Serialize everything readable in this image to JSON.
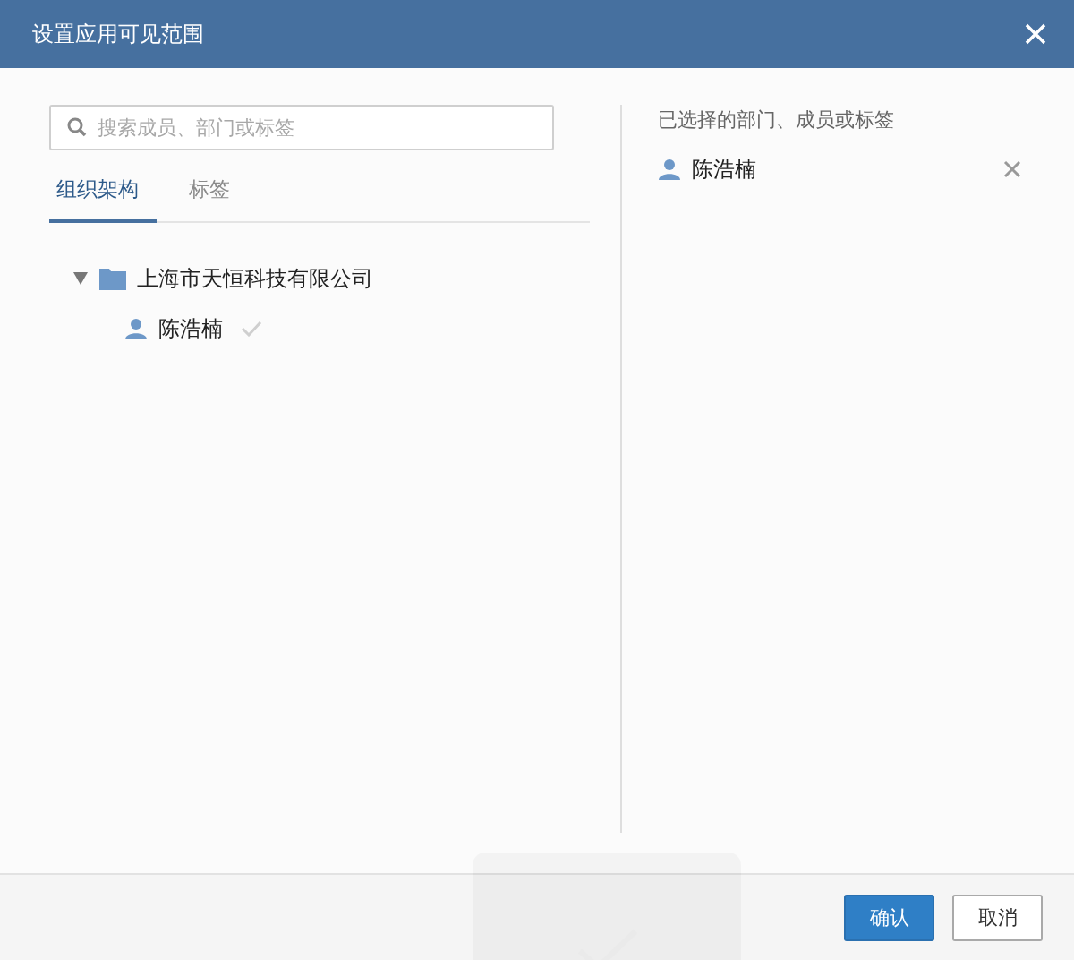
{
  "dialog": {
    "title": "设置应用可见范围"
  },
  "search": {
    "placeholder": "搜索成员、部门或标签"
  },
  "tabs": [
    {
      "label": "组织架构",
      "selected": true
    },
    {
      "label": "标签",
      "selected": false
    }
  ],
  "tree": [
    {
      "kind": "department",
      "label": "上海市天恒科技有限公司",
      "expanded": true,
      "children": [
        {
          "kind": "member",
          "label": "陈浩楠",
          "checked": true
        }
      ]
    }
  ],
  "selected_panel": {
    "title": "已选择的部门、成员或标签",
    "items": [
      {
        "label": "陈浩楠"
      }
    ]
  },
  "buttons": [
    {
      "label": "确认",
      "kind": "primary"
    },
    {
      "label": "取消",
      "kind": "secondary"
    }
  ]
}
